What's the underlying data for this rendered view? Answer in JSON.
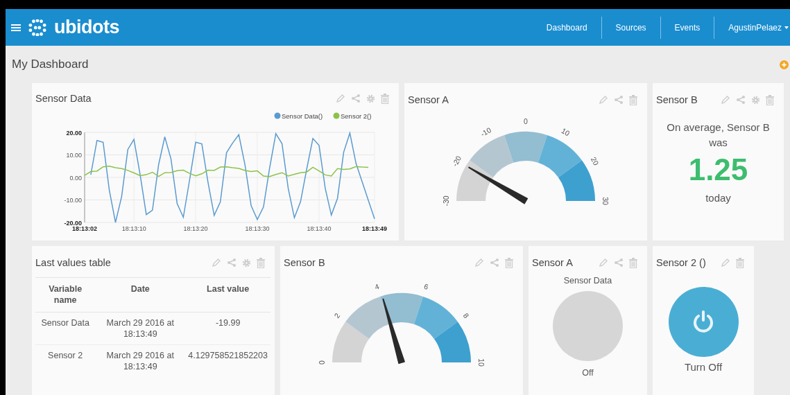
{
  "navbar": {
    "brand": "ubidots",
    "links": [
      {
        "label": "Dashboard"
      },
      {
        "label": "Sources"
      },
      {
        "label": "Events"
      }
    ],
    "user": "AgustinPelaez"
  },
  "page": {
    "title": "My Dashboard"
  },
  "rows": [
    [
      {
        "kind": "chart",
        "title": "Sensor Data",
        "chart_data": {
          "type": "line",
          "ylim": [
            -20,
            20
          ],
          "grid": true,
          "legend": true,
          "categories": [
            "18:13:02",
            null,
            null,
            null,
            null,
            null,
            null,
            null,
            "18:13:10",
            null,
            null,
            null,
            null,
            null,
            null,
            null,
            null,
            null,
            "18:13:20",
            null,
            null,
            null,
            null,
            null,
            null,
            null,
            null,
            null,
            "18:13:30",
            null,
            null,
            null,
            null,
            null,
            null,
            null,
            null,
            null,
            "18:13:40",
            null,
            null,
            null,
            null,
            null,
            null,
            null,
            null,
            "18:13:49"
          ],
          "yticks": [
            {
              "value": 20,
              "label": "20.00"
            },
            {
              "value": 10,
              "label": "10.00"
            },
            {
              "value": 0,
              "label": "0.00"
            },
            {
              "value": -10,
              "label": "-10.00"
            },
            {
              "value": -20,
              "label": "-20.00"
            }
          ],
          "series": [
            {
              "name": "Sensor Data()",
              "color": "#5b9bd0",
              "values": [
                null,
                1.2,
                16.4,
                15.6,
                -5.7,
                -20,
                -8.5,
                12.4,
                16.9,
                1.3,
                -16.5,
                -14.6,
                5.7,
                18.0,
                8.2,
                -11.6,
                -17.7,
                -1.4,
                15.6,
                14.9,
                -2.2,
                -16.9,
                -10.9,
                11,
                15.3,
                19,
                5.6,
                -12.6,
                -18.7,
                -13.1,
                4.3,
                19.4,
                15,
                -4.8,
                -17.9,
                -10.8,
                3.7,
                17.3,
                14.2,
                -4.8,
                -16.7,
                -9.3,
                11.2,
                19.7,
                6.2,
                -2.0,
                -10.2,
                -18.4
              ]
            },
            {
              "name": "Sensor 2()",
              "color": "#8bc34a",
              "values": [
                0.9,
                2.6,
                2.8,
                4.7,
                5,
                4.3,
                3.9,
                3.1,
                2.0,
                0.8,
                1.2,
                2.3,
                0.4,
                2.1,
                2.2,
                3.0,
                3.2,
                1.8,
                0.7,
                1.6,
                3.2,
                3.1,
                4.6,
                4.7,
                4.3,
                4.0,
                3.1,
                2.6,
                2.9,
                0.6,
                0.4,
                1.3,
                2.1,
                0.6,
                1.4,
                2.1,
                2.4,
                4.5,
                2.9,
                1.1,
                0.6,
                3.9,
                3.5,
                3.8,
                4.8,
                4.6,
                4.5,
                null
              ]
            }
          ]
        }
      },
      {
        "kind": "gauge",
        "title": "Sensor A",
        "ticks": [
          "-30",
          "-20",
          "-10",
          "0",
          "10",
          "20",
          "30"
        ]
      },
      {
        "kind": "metric",
        "title": "Sensor B",
        "text": "On average, Sensor B was",
        "value": "1.25",
        "suffix": "today"
      }
    ],
    [
      {
        "kind": "table",
        "title": "Last values table",
        "columns": [
          "Variable name",
          "Date",
          "Last value"
        ],
        "rows": [
          [
            "Sensor Data",
            "March 29 2016 at 18:13:49",
            "-19.99"
          ],
          [
            "Sensor 2",
            "March 29 2016 at 18:13:49",
            "4.129758521852203"
          ]
        ]
      },
      {
        "kind": "gauge",
        "title": "Sensor B",
        "ticks": [
          "0",
          "2",
          "4",
          "6",
          "8",
          "10"
        ]
      },
      {
        "kind": "indicator",
        "title": "Sensor A",
        "label": "Sensor Data",
        "on": false,
        "state_text": "Off"
      },
      {
        "kind": "switch",
        "title": "Sensor 2 ()",
        "on": true,
        "label": "Turn Off"
      }
    ]
  ]
}
